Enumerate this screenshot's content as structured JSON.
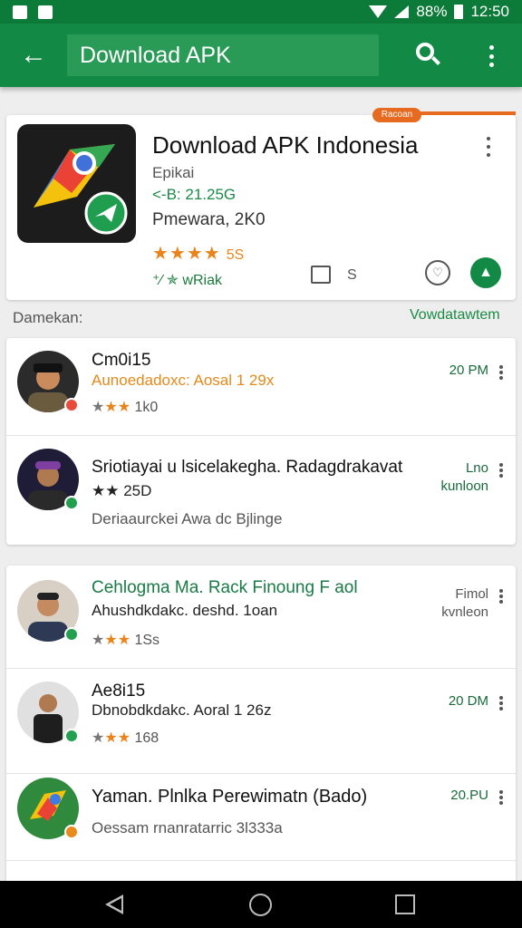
{
  "status_bar": {
    "battery": "88%",
    "time": "12:50"
  },
  "app_bar": {
    "search_text": "Download APK",
    "back_icon": "arrow-left-icon",
    "search_icon": "search-icon",
    "more_icon": "more-vert-icon"
  },
  "featured": {
    "tag": "Racoan",
    "title": "Download APK Indonesia",
    "category": "Epikai",
    "version": "<-B: 21.25G",
    "publisher": "Pmewara, 2K0",
    "stars": "★★★★",
    "rating_count": "5S",
    "badge": "⁺⁄ ✯ wRiak",
    "share_count": "S"
  },
  "section": {
    "label": "Damekan:",
    "link": "Vowdatawtem"
  },
  "list1": [
    {
      "title": "Cm0i15",
      "subtitle": "Aunoedadoxc: Aosal 1 29x",
      "subtitle_color": "#e38a1c",
      "meta_stars": "★★",
      "meta_count": "1k0",
      "time": "20 PM",
      "time2": ""
    },
    {
      "title": "Sriotiayai u lsicelakegha. Radagdrakavat",
      "subtitle": "★★ 25D",
      "subtitle_color": "#e38a1c",
      "meta_stars": "",
      "meta_count": "Deriaaurckei Awa dc Bjlinge",
      "time": "Lno",
      "time2": "kunloon"
    }
  ],
  "list2": [
    {
      "title": "Cehlogma Ma. Rack Finoung F aol",
      "subtitle": "Ahushdkdakc. deshd. 1oan",
      "subtitle_color": "#b8a412",
      "meta_stars": "★★",
      "meta_count": "1Ss",
      "time": "Fimol",
      "time2": "kvnleon"
    },
    {
      "title": "Ae8i15",
      "subtitle": "Dbnobdkdakc. Aoral 1 26z",
      "subtitle_color": "#e38a1c",
      "meta_stars": "★★",
      "meta_count": "168",
      "time": "20 DM",
      "time2": ""
    },
    {
      "title": "Yaman. Plnlka Perewimatn (Bado)",
      "subtitle": "",
      "subtitle_color": "#555555",
      "meta_stars": "",
      "meta_count": "Oessam rnanratarric 3l333a",
      "time": "20.PU",
      "time2": ""
    }
  ],
  "colors": {
    "primary": "#128a45",
    "status_bar": "#0c7a39",
    "accent_orange": "#e66a1f",
    "star": "#e8841b",
    "green_text": "#1a8a46"
  },
  "nav_bar": {
    "back_icon": "nav-back-icon",
    "home_icon": "nav-home-icon",
    "recent_icon": "nav-recent-icon"
  }
}
